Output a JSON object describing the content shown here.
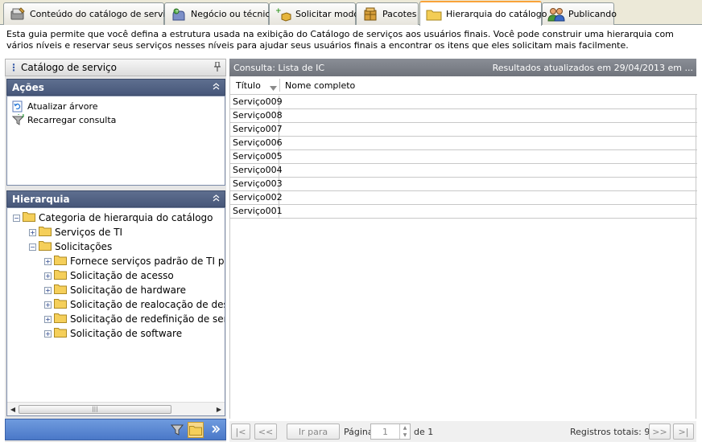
{
  "tabs": [
    {
      "label": "Conteúdo do catálogo de serviço",
      "icon": "catalog-content-icon"
    },
    {
      "label": "Negócio ou técnico",
      "icon": "business-technical-icon"
    },
    {
      "label": "Solicitar modo",
      "icon": "request-mode-icon"
    },
    {
      "label": "Pacotes",
      "icon": "packages-icon"
    },
    {
      "label": "Hierarquia do catálogo",
      "icon": "folder-icon",
      "active": true
    },
    {
      "label": "Publicando",
      "icon": "users-icon"
    }
  ],
  "description": "Esta guia permite que você defina a estrutura usada na exibição do Catálogo de serviços aos usuários finais. Você pode construir uma hierarquia com vários níveis e reservar seus serviços nesses níveis para ajudar seus usuários finais a encontrar os itens que eles solicitam mais facilmente.",
  "left_pane": {
    "title": "Catálogo de serviço",
    "actions": {
      "title": "Ações",
      "items": [
        {
          "label": "Atualizar árvore",
          "icon": "refresh-tree-icon"
        },
        {
          "label": "Recarregar consulta",
          "icon": "reload-query-icon"
        }
      ]
    },
    "hierarchy": {
      "title": "Hierarquia",
      "nodes": [
        {
          "label": "Categoria de hierarquia do catálogo",
          "level": 0,
          "state": "-"
        },
        {
          "label": "Serviços de TI",
          "level": 1,
          "state": "+"
        },
        {
          "label": "Solicitações",
          "level": 1,
          "state": "-"
        },
        {
          "label": "Fornece serviços padrão de TI para",
          "level": 2,
          "state": "+"
        },
        {
          "label": "Solicitação de acesso",
          "level": 2,
          "state": "+"
        },
        {
          "label": "Solicitação de hardware",
          "level": 2,
          "state": "+"
        },
        {
          "label": "Solicitação de realocação de desktc",
          "level": 2,
          "state": "+"
        },
        {
          "label": "Solicitação de redefinição de senha",
          "level": 2,
          "state": "+"
        },
        {
          "label": "Solicitação de software",
          "level": 2,
          "state": "+"
        }
      ]
    }
  },
  "results": {
    "query_label": "Consulta: Lista de IC",
    "updated_label": "Resultados atualizados em 29/04/2013 em ...",
    "columns": [
      "Título",
      "Nome completo"
    ],
    "rows": [
      {
        "title": "Serviço009",
        "full_name": ""
      },
      {
        "title": "Serviço008",
        "full_name": ""
      },
      {
        "title": "Serviço007",
        "full_name": ""
      },
      {
        "title": "Serviço006",
        "full_name": ""
      },
      {
        "title": "Serviço005",
        "full_name": ""
      },
      {
        "title": "Serviço004",
        "full_name": ""
      },
      {
        "title": "Serviço003",
        "full_name": ""
      },
      {
        "title": "Serviço002",
        "full_name": ""
      },
      {
        "title": "Serviço001",
        "full_name": ""
      }
    ]
  },
  "pager": {
    "first": "|<",
    "prev": "<<",
    "goto": "Ir para",
    "page_label": "Página",
    "page_value": "1",
    "of_label": "de 1",
    "total_label": "Registros totais: 9",
    "next": ">>",
    "last": ">|"
  }
}
